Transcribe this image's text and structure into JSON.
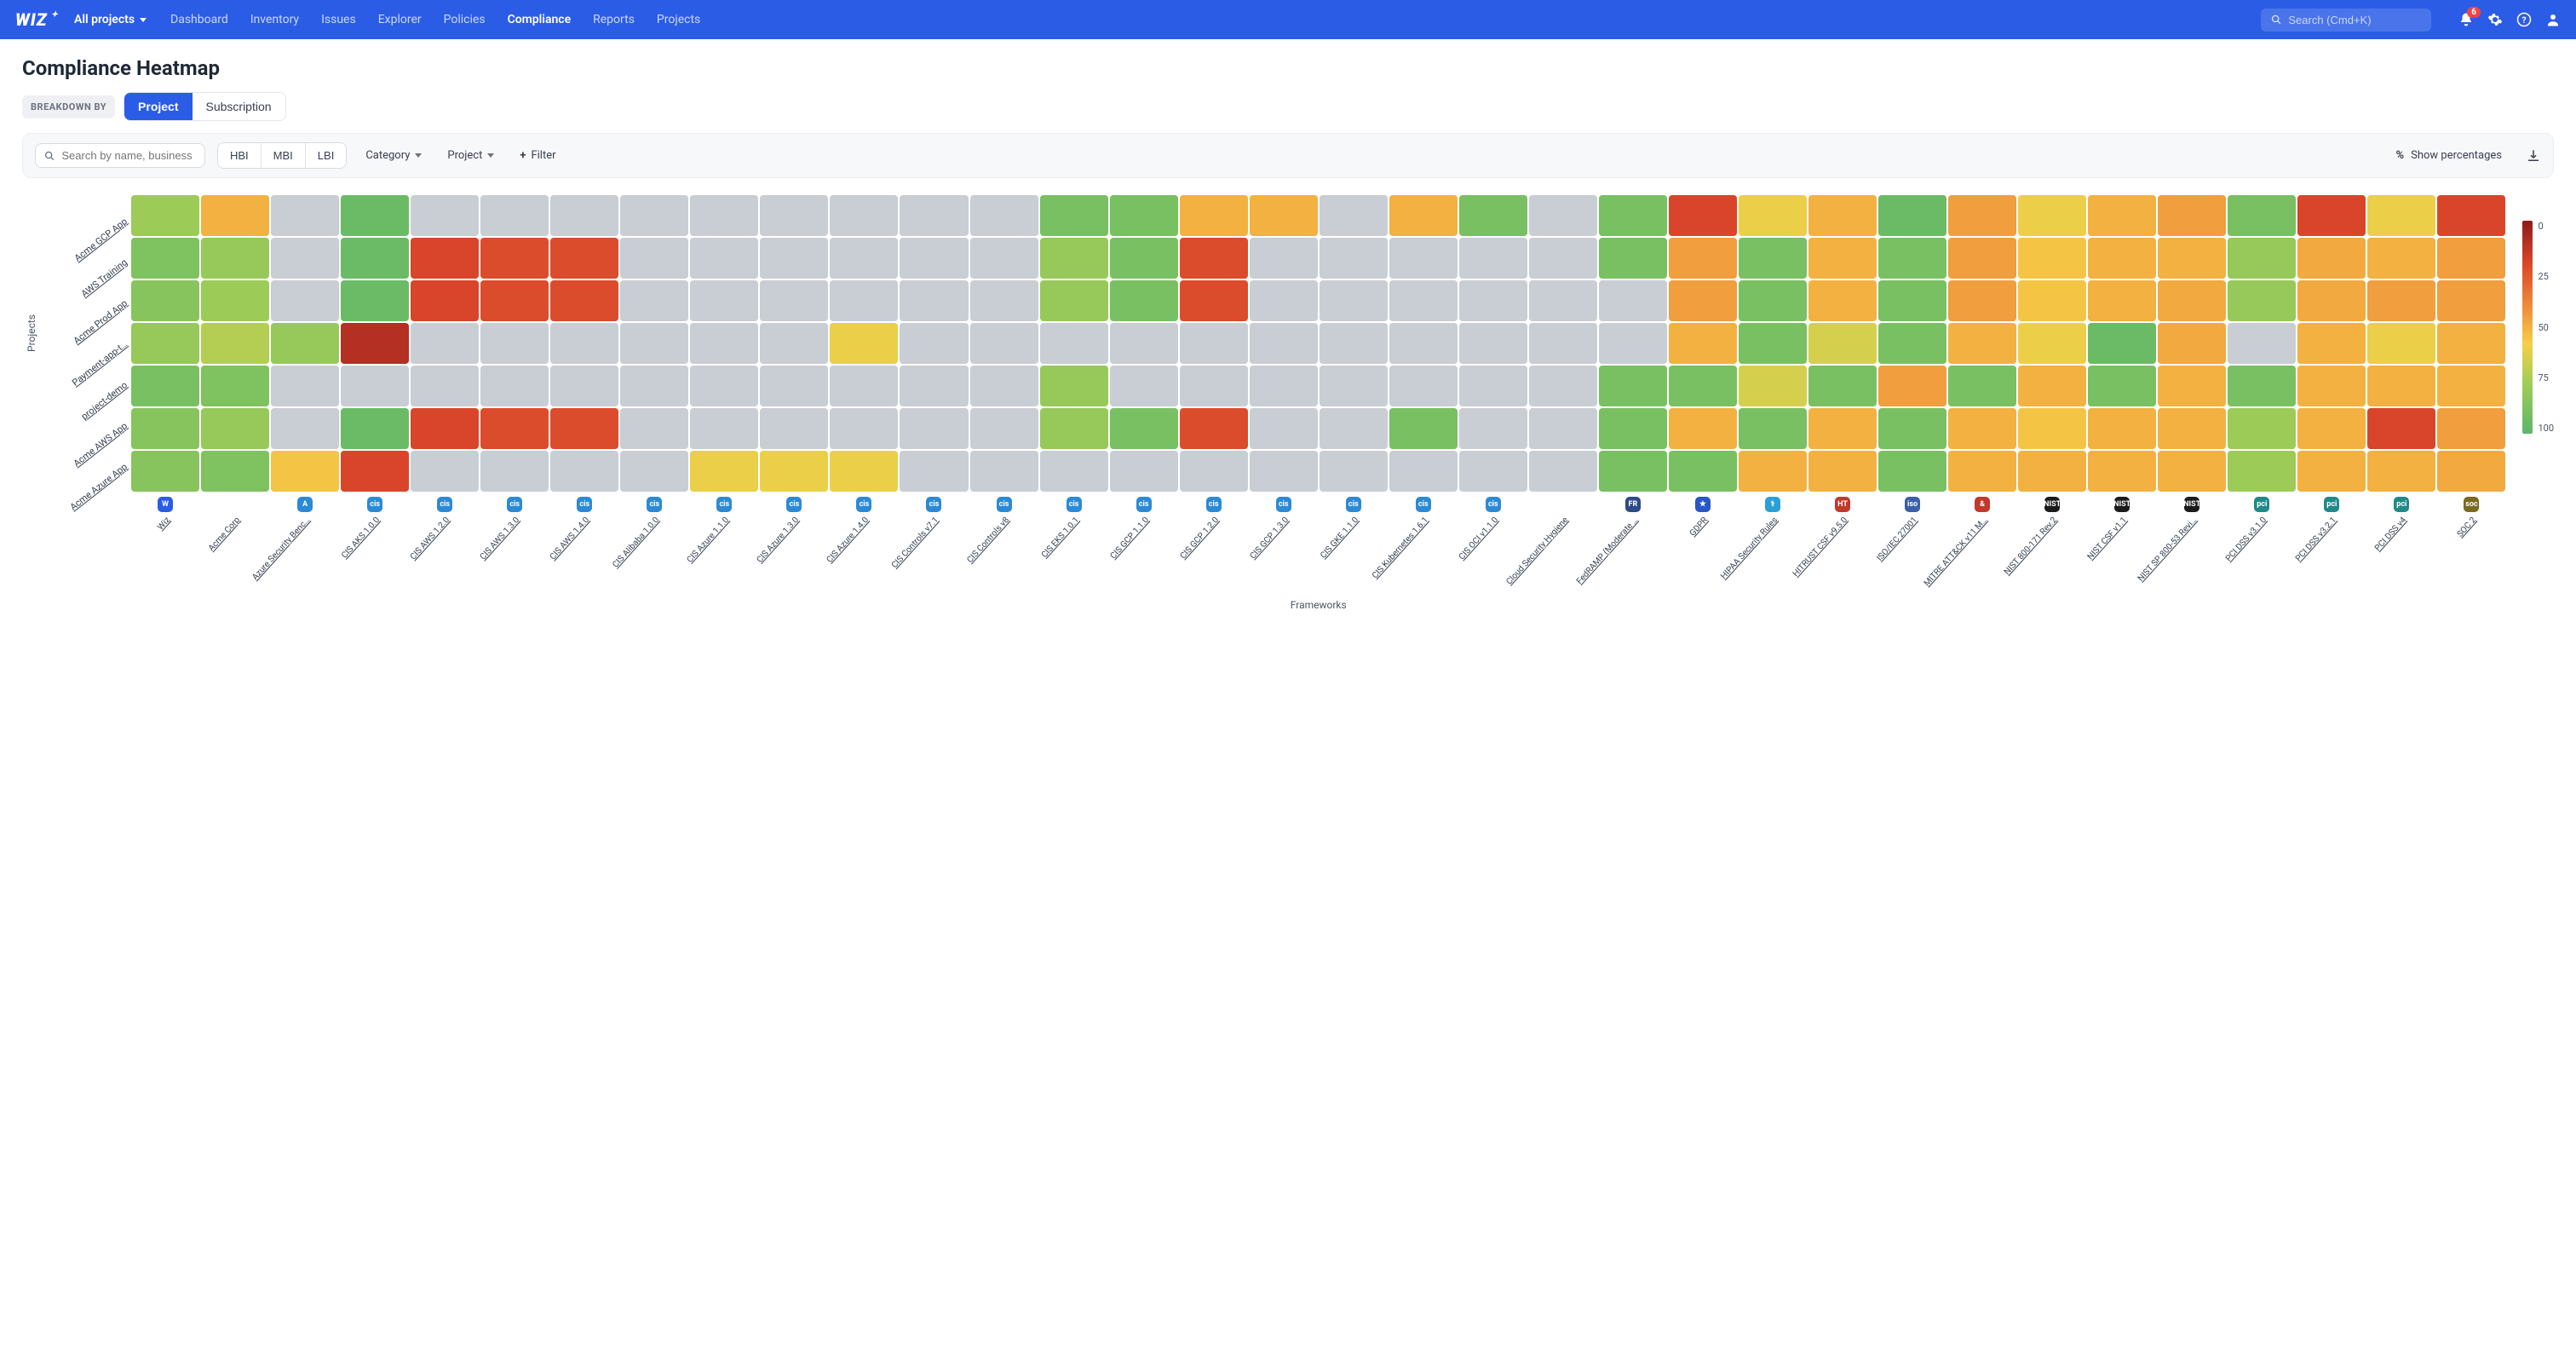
{
  "header": {
    "logo": "WIZ",
    "project_selector": "All projects",
    "nav": [
      "Dashboard",
      "Inventory",
      "Issues",
      "Explorer",
      "Policies",
      "Compliance",
      "Reports",
      "Projects"
    ],
    "nav_active": "Compliance",
    "search_placeholder": "Search (Cmd+K)",
    "notification_count": "6"
  },
  "page": {
    "title": "Compliance Heatmap",
    "breakdown_label": "BREAKDOWN BY",
    "breakdown_options": [
      "Project",
      "Subscription"
    ],
    "breakdown_active": "Project",
    "toolbar": {
      "search_placeholder": "Search by name, business unit",
      "impact_pills": [
        "HBI",
        "MBI",
        "LBI"
      ],
      "category_label": "Category",
      "project_label": "Project",
      "filter_label": "Filter",
      "pct_label": "Show percentages"
    }
  },
  "chart_data": {
    "type": "heatmap",
    "xlabel": "Frameworks",
    "ylabel": "Projects",
    "legend_ticks": [
      "0",
      "25",
      "50",
      "75",
      "100"
    ],
    "projects": [
      "Acme GCP App",
      "AWS Training",
      "Acme Prod App",
      "Payment-app-t…",
      "project-demo",
      "Acme AWS App",
      "Acme Azure App"
    ],
    "frameworks": [
      {
        "label": "Wiz",
        "icon_color": "#2b5ce6",
        "icon_text": "W"
      },
      {
        "label": "Acme Corp",
        "icon_color": "",
        "icon_text": ""
      },
      {
        "label": "Azure Security Benc…",
        "icon_color": "#2b8ad6",
        "icon_text": "A"
      },
      {
        "label": "CIS AKS 1.0.0",
        "icon_color": "#2b8ad6",
        "icon_text": "cis"
      },
      {
        "label": "CIS AWS 1.2.0",
        "icon_color": "#2b8ad6",
        "icon_text": "cis"
      },
      {
        "label": "CIS AWS 1.3.0",
        "icon_color": "#2b8ad6",
        "icon_text": "cis"
      },
      {
        "label": "CIS AWS 1.4.0",
        "icon_color": "#2b8ad6",
        "icon_text": "cis"
      },
      {
        "label": "CIS Alibaba 1.0.0",
        "icon_color": "#2b8ad6",
        "icon_text": "cis"
      },
      {
        "label": "CIS Azure 1.1.0",
        "icon_color": "#2b8ad6",
        "icon_text": "cis"
      },
      {
        "label": "CIS Azure 1.3.0",
        "icon_color": "#2b8ad6",
        "icon_text": "cis"
      },
      {
        "label": "CIS Azure 1.4.0",
        "icon_color": "#2b8ad6",
        "icon_text": "cis"
      },
      {
        "label": "CIS Controls v7.1",
        "icon_color": "#2b8ad6",
        "icon_text": "cis"
      },
      {
        "label": "CIS Controls v8",
        "icon_color": "#2b8ad6",
        "icon_text": "cis"
      },
      {
        "label": "CIS EKS 1.0.1",
        "icon_color": "#2b8ad6",
        "icon_text": "cis"
      },
      {
        "label": "CIS GCP 1.1.0",
        "icon_color": "#2b8ad6",
        "icon_text": "cis"
      },
      {
        "label": "CIS GCP 1.2.0",
        "icon_color": "#2b8ad6",
        "icon_text": "cis"
      },
      {
        "label": "CIS GCP 1.3.0",
        "icon_color": "#2b8ad6",
        "icon_text": "cis"
      },
      {
        "label": "CIS GKE 1.1.0",
        "icon_color": "#2b8ad6",
        "icon_text": "cis"
      },
      {
        "label": "CIS Kubernetes 1.6.1",
        "icon_color": "#2b8ad6",
        "icon_text": "cis"
      },
      {
        "label": "CIS OCI v1.1.0",
        "icon_color": "#2b8ad6",
        "icon_text": "cis"
      },
      {
        "label": "Cloud Security Hygiene",
        "icon_color": "",
        "icon_text": ""
      },
      {
        "label": "FedRAMP (Moderate …",
        "icon_color": "#2f4a88",
        "icon_text": "FR"
      },
      {
        "label": "GDPR",
        "icon_color": "#2756c7",
        "icon_text": "★"
      },
      {
        "label": "HIPAA Security Rules",
        "icon_color": "#2aa0d8",
        "icon_text": "⚕"
      },
      {
        "label": "HITRUST CSF v9.5.0",
        "icon_color": "#c0392b",
        "icon_text": "HT"
      },
      {
        "label": "ISO/IEC 27001",
        "icon_color": "#3b5fa8",
        "icon_text": "iso"
      },
      {
        "label": "MITRE ATT&CK v11 M…",
        "icon_color": "#c0392b",
        "icon_text": "&"
      },
      {
        "label": "NIST 800-171 Rev.2",
        "icon_color": "#1b1b1b",
        "icon_text": "NIST"
      },
      {
        "label": "NIST CSF v1.1",
        "icon_color": "#1b1b1b",
        "icon_text": "NIST"
      },
      {
        "label": "NIST SP 800-53 Revi…",
        "icon_color": "#1b1b1b",
        "icon_text": "NIST"
      },
      {
        "label": "PCI DSS v3.1.0",
        "icon_color": "#1f8a87",
        "icon_text": "pci"
      },
      {
        "label": "PCI DSS v3.2.1",
        "icon_color": "#1f8a87",
        "icon_text": "pci"
      },
      {
        "label": "PCI DSS v4",
        "icon_color": "#1f8a87",
        "icon_text": "pci"
      },
      {
        "label": "SOC 2",
        "icon_color": "#7a6a1f",
        "icon_text": "soc"
      }
    ],
    "values": [
      [
        78,
        50,
        null,
        95,
        null,
        null,
        null,
        null,
        null,
        null,
        null,
        null,
        null,
        90,
        90,
        50,
        50,
        null,
        50,
        90,
        null,
        90,
        20,
        60,
        50,
        95,
        45,
        60,
        50,
        45,
        90,
        20,
        60,
        20
      ],
      [
        88,
        80,
        null,
        95,
        20,
        22,
        22,
        null,
        null,
        null,
        null,
        null,
        null,
        80,
        90,
        22,
        null,
        null,
        null,
        null,
        null,
        90,
        45,
        90,
        50,
        90,
        45,
        55,
        50,
        50,
        80,
        48,
        50,
        45
      ],
      [
        85,
        78,
        null,
        95,
        20,
        22,
        22,
        null,
        null,
        null,
        null,
        null,
        null,
        80,
        90,
        22,
        null,
        null,
        null,
        null,
        null,
        null,
        45,
        90,
        50,
        90,
        45,
        55,
        50,
        48,
        80,
        48,
        45,
        45
      ],
      [
        80,
        72,
        80,
        10,
        null,
        null,
        null,
        null,
        null,
        null,
        60,
        null,
        null,
        null,
        null,
        null,
        null,
        null,
        null,
        null,
        null,
        null,
        50,
        90,
        65,
        90,
        50,
        60,
        95,
        48,
        null,
        50,
        60,
        50
      ],
      [
        90,
        88,
        null,
        null,
        null,
        null,
        null,
        null,
        null,
        null,
        null,
        null,
        null,
        80,
        null,
        null,
        null,
        null,
        null,
        null,
        null,
        90,
        90,
        65,
        90,
        45,
        90,
        50,
        90,
        50,
        90,
        50,
        50,
        50
      ],
      [
        85,
        80,
        null,
        95,
        20,
        22,
        22,
        null,
        null,
        null,
        null,
        null,
        null,
        80,
        90,
        22,
        null,
        null,
        90,
        null,
        null,
        90,
        50,
        90,
        50,
        90,
        50,
        55,
        50,
        50,
        78,
        50,
        20,
        45
      ],
      [
        85,
        88,
        55,
        20,
        null,
        null,
        null,
        null,
        60,
        60,
        60,
        null,
        null,
        null,
        null,
        null,
        null,
        null,
        null,
        null,
        null,
        90,
        90,
        50,
        50,
        90,
        50,
        50,
        50,
        50,
        78,
        50,
        50,
        48
      ]
    ],
    "color_scale": [
      {
        "t": 0,
        "c": "#5cb66a"
      },
      {
        "t": 25,
        "c": "#a5ce55"
      },
      {
        "t": 42,
        "c": "#f5cf47"
      },
      {
        "t": 60,
        "c": "#ee8b3a"
      },
      {
        "t": 80,
        "c": "#d9452a"
      },
      {
        "t": 100,
        "c": "#8e1a1a"
      }
    ],
    "null_color": "#c9cdd4"
  }
}
